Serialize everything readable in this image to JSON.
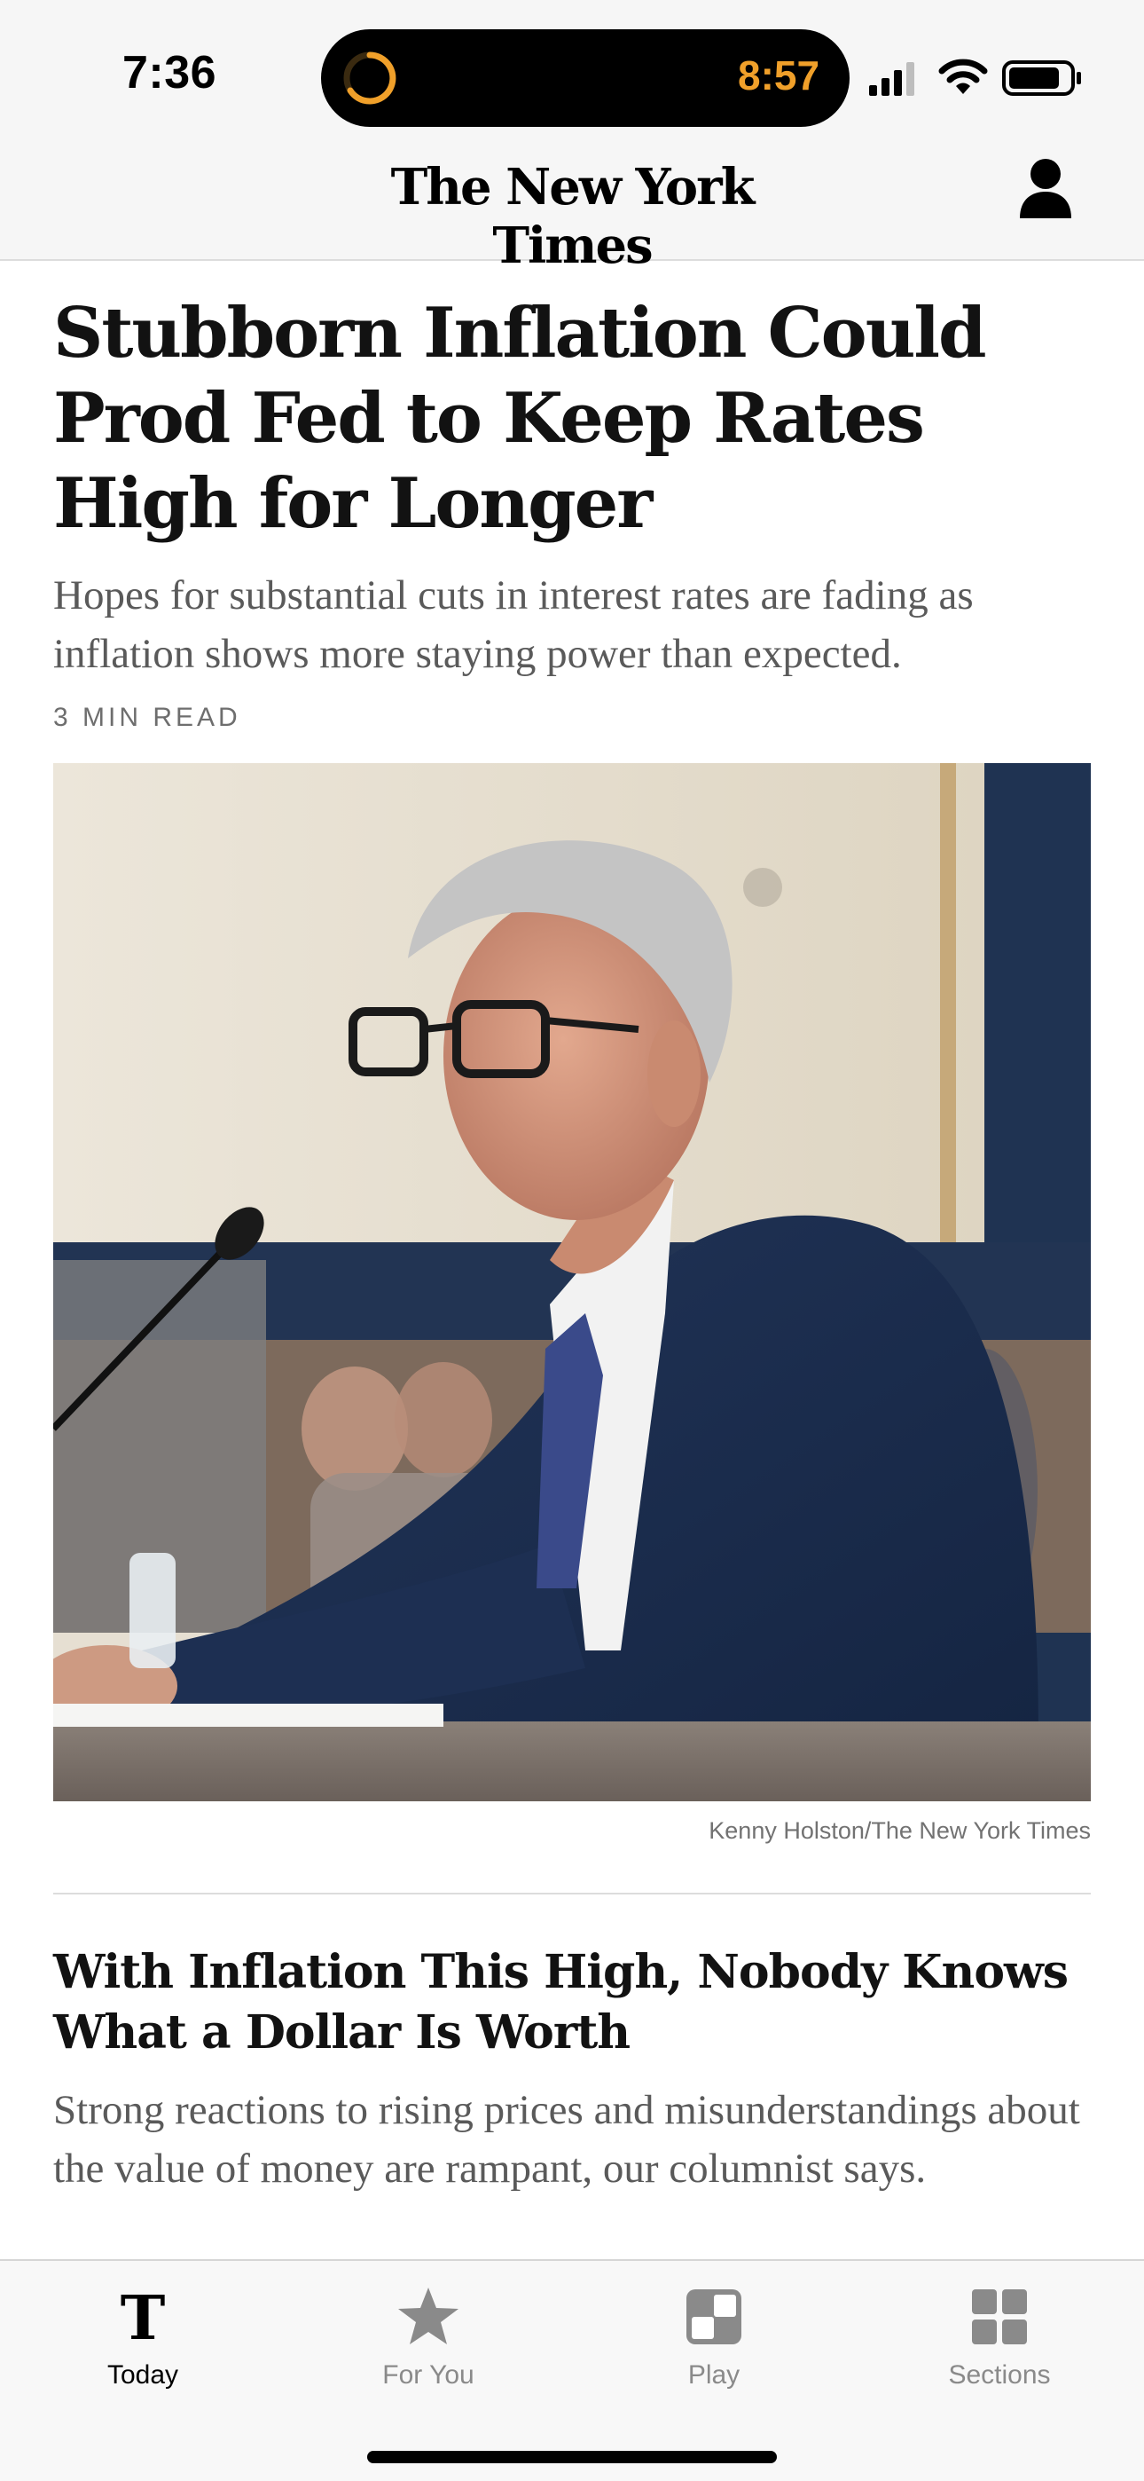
{
  "status_bar": {
    "time": "7:36",
    "live_activity_time": "8:57",
    "icons": [
      "timer-icon",
      "cellular-signal-icon",
      "wifi-icon",
      "battery-icon"
    ]
  },
  "header": {
    "masthead": "The New York Times",
    "account_icon": "person-icon"
  },
  "lead_story": {
    "headline": "Stubborn Inflation Could Prod Fed to Keep Rates High for Longer",
    "summary": "Hopes for substantial cuts in interest rates are fading as inflation shows more staying power than expected.",
    "read_time": "3 MIN READ",
    "photo_credit": "Kenny Holston/The New York Times"
  },
  "second_story": {
    "headline": "With Inflation This High, Nobody Knows What a Dollar Is Worth",
    "summary": "Strong reactions to rising prices and misunderstandings about the value of money are rampant, our columnist says."
  },
  "tab_bar": {
    "tabs": [
      {
        "label": "Today",
        "icon": "nyt-t-logo-icon",
        "active": true
      },
      {
        "label": "For You",
        "icon": "star-icon",
        "active": false
      },
      {
        "label": "Play",
        "icon": "games-icon",
        "active": false
      },
      {
        "label": "Sections",
        "icon": "grid-icon",
        "active": false
      }
    ]
  },
  "colors": {
    "live_activity_accent": "#f0a02a",
    "headline": "#121212",
    "summary": "#5a5a5a",
    "inactive_tab": "#8a8a8a"
  }
}
